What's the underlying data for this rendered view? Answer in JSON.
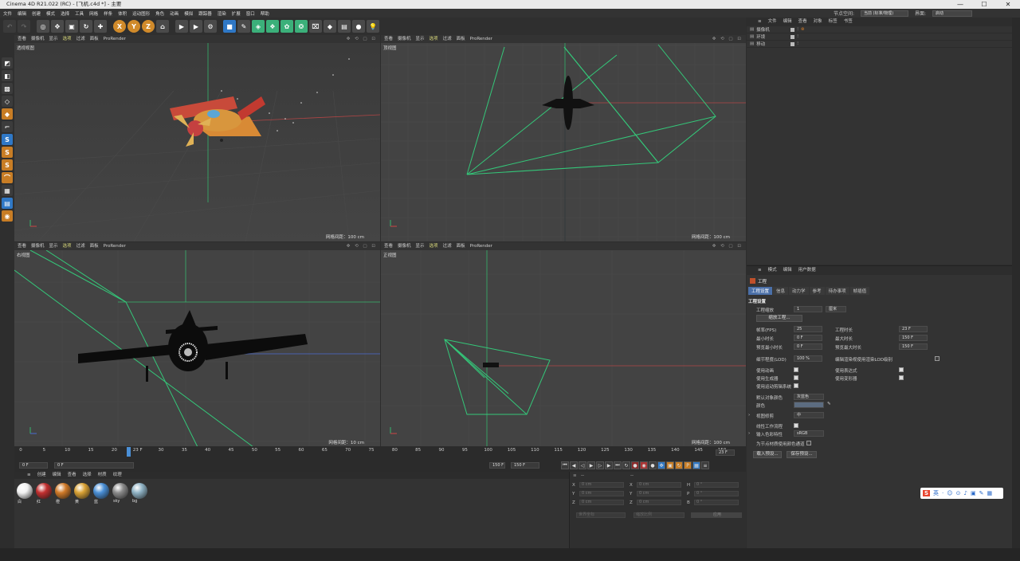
{
  "title": "Cinema 4D R21.022 (RC) - [飞机.c4d *] - 主要",
  "window_controls": [
    "—",
    "☐",
    "✕"
  ],
  "menu": [
    "文件",
    "编辑",
    "创建",
    "模式",
    "选择",
    "工具",
    "网格",
    "样条",
    "体积",
    "运动图形",
    "角色",
    "动画",
    "模拟",
    "跟踪器",
    "渲染",
    "扩展",
    "窗口",
    "帮助"
  ],
  "node_space_label": "节点空间:",
  "node_space_value": "当前 (标准/物理)",
  "layout_label": "界面:",
  "layout_value": "启动",
  "viewport_menu": [
    "查看",
    "摄像机",
    "显示",
    "选项",
    "过滤",
    "面板",
    "ProRender"
  ],
  "viewports": [
    {
      "label": "透视视图",
      "grid": "网格间距：100 cm",
      "active_menu": "选项"
    },
    {
      "label": "顶视图",
      "grid": "网格间距：100 cm",
      "active_menu": "选项"
    },
    {
      "label": "右视图",
      "grid": "网格间距：10 cm",
      "active_menu": "选项"
    },
    {
      "label": "正视图",
      "grid": "网格间距：100 cm",
      "active_menu": "选项"
    }
  ],
  "timeline": {
    "ticks": [
      "0",
      "5",
      "10",
      "15",
      "20",
      "23 F",
      "30",
      "35",
      "40",
      "45",
      "50",
      "55",
      "60",
      "65",
      "70",
      "75",
      "80",
      "85",
      "90",
      "95",
      "100",
      "105",
      "110",
      "115",
      "120",
      "125",
      "130",
      "135",
      "140",
      "145",
      "150"
    ],
    "current": "23 F",
    "start": "0 F",
    "offset": "0 F",
    "end_a": "150 F",
    "end_b": "150 F",
    "current_frame_field": "23 F",
    "current_frame": 23,
    "max_frame": 150
  },
  "material_menu": [
    "创建",
    "编辑",
    "查看",
    "选择",
    "材质",
    "纹理"
  ],
  "materials": [
    {
      "name": "白",
      "color": "#f2f2f2"
    },
    {
      "name": "红",
      "color": "#c23030"
    },
    {
      "name": "橙",
      "color": "#d07a28"
    },
    {
      "name": "黄",
      "color": "#d9a235"
    },
    {
      "name": "蓝",
      "color": "#4a8fd6"
    },
    {
      "name": "sky",
      "color": "#8a8a8a"
    },
    {
      "name": "bg",
      "color": "#8fb2c4"
    }
  ],
  "coords": {
    "rows": [
      {
        "a": "X",
        "av": "0 cm",
        "b": "X",
        "bv": "0 cm",
        "c": "H",
        "cv": "0 °"
      },
      {
        "a": "Y",
        "av": "0 cm",
        "b": "Y",
        "bv": "0 cm",
        "c": "P",
        "cv": "0 °"
      },
      {
        "a": "Z",
        "av": "0 cm",
        "b": "Z",
        "bv": "0 cm",
        "c": "B",
        "cv": "0 °"
      }
    ],
    "dropdown_a": "世界坐标",
    "dropdown_b": "缩放比例",
    "apply": "应用",
    "header_a": "--",
    "header_b": "--"
  },
  "object_manager": {
    "menu": [
      "文件",
      "编辑",
      "查看",
      "对象",
      "标签",
      "书签"
    ],
    "objects": [
      "摄像机",
      "环境",
      "移动"
    ]
  },
  "attribute_manager": {
    "menu": [
      "模式",
      "编辑",
      "用户数据"
    ],
    "title": "工程",
    "tabs": [
      "工程设置",
      "信息",
      "动力学",
      "参考",
      "待办事项",
      "帧插值"
    ],
    "section": "工程设置",
    "scale_label": "工程缩放",
    "scale_value": "1",
    "scale_unit": "厘米",
    "scale_button": "缩放工程...",
    "fps_label": "帧率(FPS)",
    "fps_value": "25",
    "time_label": "工程时长",
    "time_value": "23 F",
    "min_label": "最小时长",
    "min_value": "0 F",
    "max_label": "最大时长",
    "max_value": "150 F",
    "pmin_label": "预览最小时长",
    "pmin_value": "0 F",
    "pmax_label": "预览最大时长",
    "pmax_value": "150 F",
    "lod_label": "细节程度(LOD)",
    "lod_value": "100 %",
    "lod_render_label": "编辑渲染视使用渲染LOD级别",
    "anim_label": "使用动画",
    "expr_label": "使用表达式",
    "gen_label": "使用生成器",
    "deform_label": "使用变形器",
    "motion_label": "使用运动剪辑系统",
    "objcolor_label": "默认对象颜色",
    "objcolor_value": "灰蓝色",
    "color_label": "颜色",
    "view_clip_label": "视图修剪",
    "view_clip_value": "中",
    "linear_label": "线性工作流程",
    "input_color_label": "输入色彩特性",
    "input_color_value": "sRGB",
    "node_color_label": "为节点材质使用颜色通道",
    "load_preset": "载入预设...",
    "save_preset": "保存预设..."
  },
  "ime": [
    "S",
    "英",
    "·",
    "☺",
    "⊙",
    "♪",
    "▣",
    "✎",
    "▦"
  ]
}
